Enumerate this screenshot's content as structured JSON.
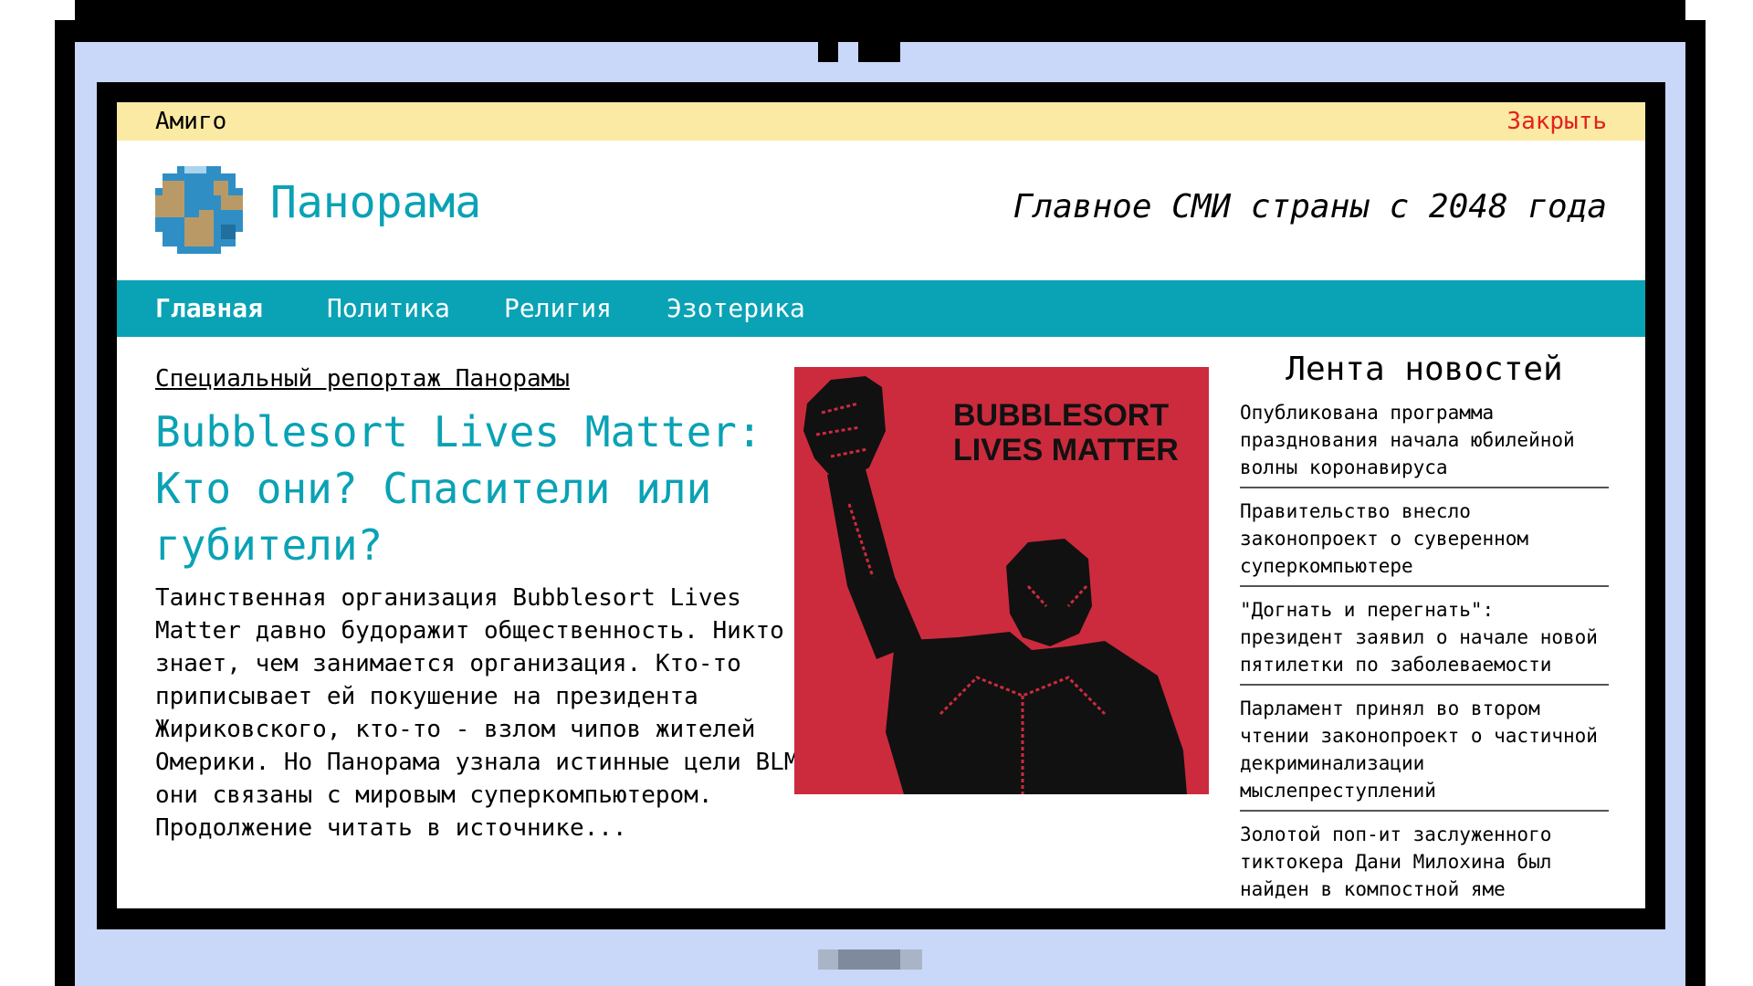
{
  "topbar": {
    "app_name": "Амиго",
    "close_label": "Закрыть"
  },
  "header": {
    "brand": "Панорама",
    "slogan": "Главное СМИ страны с 2048 года",
    "logo_icon": "globe-icon"
  },
  "nav": {
    "tabs": [
      {
        "label": "Главная",
        "active": true
      },
      {
        "label": "Политика",
        "active": false
      },
      {
        "label": "Религия",
        "active": false
      },
      {
        "label": "Эзотерика",
        "active": false
      }
    ]
  },
  "article": {
    "kicker": "Специальный репортаж Панорамы",
    "headline": "Bubblesort Lives Matter: Кто они? Спасители или губители?",
    "body": "Таинственная организация Bubblesort Lives Matter давно будоражит общественность. Никто не знает, чем занимается организация. Кто-то приписывает ей покушение на президента Жириковского, кто-то - взлом чипов жителей Омерики. Но Панорама узнала истинные цели BLM и они связаны с мировым суперкомпьютером. Продолжение читать в источнике...",
    "poster": {
      "line1": "BUBBLESORT",
      "line2": "LIVES MATTER",
      "background": "#cc2b3d"
    }
  },
  "feed": {
    "title": "Лента новостей",
    "items": [
      "Опубликована программа празднования начала юбилейной волны коронавируса",
      "Правительство внесло законопроект о суверенном суперкомпьютере",
      "\"Догнать и перегнать\": президент заявил о начале новой пятилетки по заболеваемости",
      "Парламент принял во втором чтении законопроект о частичной декриминализации мыслепреступлений",
      "Золотой поп-ит заслуженного тиктокера Дани Милохина был найден в компостной яме"
    ]
  },
  "colors": {
    "accent": "#0aa2b5",
    "topbar": "#fbeaa3",
    "close": "#e52020",
    "bezel": "#c9d8f8"
  }
}
